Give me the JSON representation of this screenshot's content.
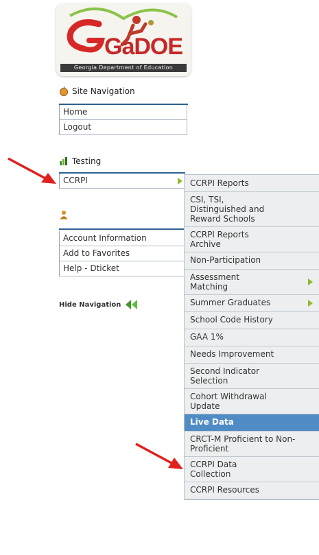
{
  "logo": {
    "brand": "GaDOE",
    "tagline": "Georgia Department of Education"
  },
  "site_navigation": {
    "title": "Site Navigation",
    "items": [
      {
        "label": "Home"
      },
      {
        "label": "Logout"
      }
    ]
  },
  "testing": {
    "title": "Testing",
    "items": [
      {
        "label": "CCRPI",
        "has_submenu": true
      }
    ]
  },
  "account_menu": {
    "items": [
      {
        "label": "Account Information"
      },
      {
        "label": "Add to Favorites"
      },
      {
        "label": "Help - Dticket"
      }
    ]
  },
  "hide_navigation": {
    "label": "Hide Navigation"
  },
  "ccrpi_submenu": {
    "items": [
      {
        "label": "CCRPI Reports"
      },
      {
        "label": "CSI, TSI, Distinguished and Reward Schools"
      },
      {
        "label": "CCRPI Reports Archive"
      },
      {
        "label": "Non-Participation"
      },
      {
        "label": "Assessment Matching",
        "has_submenu": true
      },
      {
        "label": "Summer Graduates",
        "has_submenu": true
      },
      {
        "label": "School Code History"
      },
      {
        "label": "GAA 1%"
      },
      {
        "label": "Needs Improvement"
      },
      {
        "label": "Second Indicator Selection"
      },
      {
        "label": "Cohort Withdrawal Update"
      },
      {
        "label": "Live Data",
        "active": true
      },
      {
        "label": "CRCT-M Proficient to Non-Proficient"
      },
      {
        "label": "CCRPI Data Collection"
      },
      {
        "label": "CCRPI Resources"
      }
    ]
  },
  "colors": {
    "accent_blue": "#2e5f8f",
    "active_item": "#4f8bc4",
    "submenu_bg": "#edeeef",
    "arrow_green": "#8dbb2d",
    "annotation_red": "#e0201c"
  }
}
